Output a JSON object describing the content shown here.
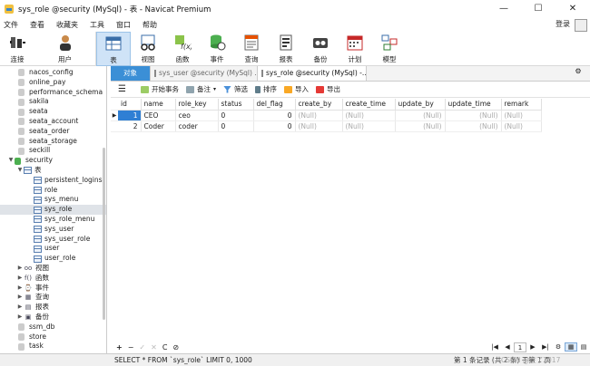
{
  "window": {
    "title": "sys_role @security (MySql) - 表 - Navicat Premium",
    "controls": {
      "minimize": "—",
      "maximize": "☐",
      "close": "✕"
    }
  },
  "menu": {
    "items": [
      "文件",
      "查看",
      "收藏夹",
      "工具",
      "窗口",
      "帮助"
    ],
    "login": "登录"
  },
  "toolbar": {
    "items": [
      {
        "label": "连接",
        "icon": "connection-icon"
      },
      {
        "label": "用户",
        "icon": "user-icon"
      },
      {
        "label": "表",
        "icon": "table-icon",
        "active": true
      },
      {
        "label": "视图",
        "icon": "view-icon"
      },
      {
        "label": "函数",
        "icon": "function-icon"
      },
      {
        "label": "事件",
        "icon": "event-icon"
      },
      {
        "label": "查询",
        "icon": "query-icon"
      },
      {
        "label": "报表",
        "icon": "report-icon"
      },
      {
        "label": "备份",
        "icon": "backup-icon"
      },
      {
        "label": "计划",
        "icon": "schedule-icon"
      },
      {
        "label": "模型",
        "icon": "model-icon"
      }
    ]
  },
  "tabs": {
    "objects": "对象",
    "inactive": "sys_user @security (MySql) ...",
    "current": "sys_role @security (MySql) -..."
  },
  "sidebar": {
    "rows": [
      {
        "label": "nacos_config",
        "type": "db"
      },
      {
        "label": "online_pay",
        "type": "db"
      },
      {
        "label": "performance_schema",
        "type": "db"
      },
      {
        "label": "sakila",
        "type": "db"
      },
      {
        "label": "seata",
        "type": "db"
      },
      {
        "label": "seata_account",
        "type": "db"
      },
      {
        "label": "seata_order",
        "type": "db"
      },
      {
        "label": "seata_storage",
        "type": "db"
      },
      {
        "label": "seckill",
        "type": "db"
      },
      {
        "label": "security",
        "type": "db-open"
      },
      {
        "label": "表",
        "type": "group-open"
      },
      {
        "label": "persistent_logins",
        "type": "table"
      },
      {
        "label": "role",
        "type": "table"
      },
      {
        "label": "sys_menu",
        "type": "table"
      },
      {
        "label": "sys_role",
        "type": "table",
        "selected": true
      },
      {
        "label": "sys_role_menu",
        "type": "table"
      },
      {
        "label": "sys_user",
        "type": "table"
      },
      {
        "label": "sys_user_role",
        "type": "table"
      },
      {
        "label": "user",
        "type": "table"
      },
      {
        "label": "user_role",
        "type": "table"
      },
      {
        "label": "视图",
        "type": "group",
        "glyph": "oo"
      },
      {
        "label": "函数",
        "type": "group",
        "glyph": "f()"
      },
      {
        "label": "事件",
        "type": "group",
        "glyph": "⌚"
      },
      {
        "label": "查询",
        "type": "group",
        "glyph": "▦"
      },
      {
        "label": "报表",
        "type": "group",
        "glyph": "▤"
      },
      {
        "label": "备份",
        "type": "group",
        "glyph": "▣"
      },
      {
        "label": "ssm_db",
        "type": "db"
      },
      {
        "label": "store",
        "type": "db"
      },
      {
        "label": "task",
        "type": "db"
      }
    ]
  },
  "subtoolbar": {
    "menu_icon": "☰",
    "begin_tx": "开始事务",
    "note": "备注",
    "filter": "筛选",
    "sort": "排序",
    "import": "导入",
    "export": "导出"
  },
  "grid": {
    "columns": [
      "id",
      "name",
      "role_key",
      "status",
      "del_flag",
      "create_by",
      "create_time",
      "update_by",
      "update_time",
      "remark"
    ],
    "rows": [
      [
        "1",
        "CEO",
        "ceo",
        "0",
        "0",
        "(Null)",
        "(Null)",
        "(Null)",
        "(Null)",
        "(Null)"
      ],
      [
        "2",
        "Coder",
        "coder",
        "0",
        "0",
        "(Null)",
        "(Null)",
        "(Null)",
        "(Null)",
        "(Null)"
      ]
    ],
    "row_marker": "▶"
  },
  "bottombar": {
    "buttons": [
      "+",
      "−",
      "✓",
      "✕",
      "C",
      "⊘"
    ],
    "page": "1"
  },
  "status": {
    "sql": "SELECT * FROM `sys_role` LIMIT 0, 1000",
    "records": "第 1 条记录 (共 2 条) 于第 1 页",
    "watermark": "CSDN @在了2017"
  }
}
